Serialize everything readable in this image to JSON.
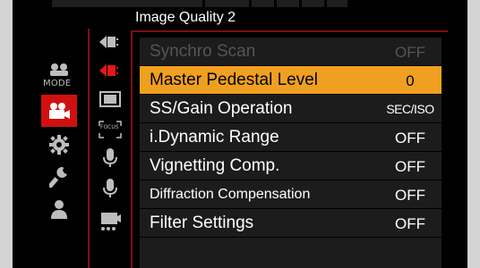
{
  "header": {
    "title": "Image Quality 2"
  },
  "categories": [
    {
      "name": "mode",
      "label": "MODE",
      "active": false
    },
    {
      "name": "motion-picture",
      "active": true
    },
    {
      "name": "custom-gear",
      "active": false
    },
    {
      "name": "setup-wrench",
      "active": false
    },
    {
      "name": "my-menu-person",
      "active": false
    }
  ],
  "tabs": [
    {
      "name": "image-quality-1"
    },
    {
      "name": "image-quality-2",
      "active": true
    },
    {
      "name": "image-format"
    },
    {
      "name": "focus",
      "label": "FOCUS"
    },
    {
      "name": "audio-1"
    },
    {
      "name": "audio-2"
    },
    {
      "name": "other-functions"
    }
  ],
  "menu": {
    "items": [
      {
        "label": "Synchro Scan",
        "value": "OFF",
        "state": "disabled"
      },
      {
        "label": "Master Pedestal Level",
        "value": "0",
        "state": "selected"
      },
      {
        "label": "SS/Gain Operation",
        "value": "SEC/ISO",
        "state": "normal"
      },
      {
        "label": "i.Dynamic Range",
        "value": "OFF",
        "state": "normal"
      },
      {
        "label": "Vignetting Comp.",
        "value": "OFF",
        "state": "normal"
      },
      {
        "label": "Diffraction Compensation",
        "value": "OFF",
        "state": "normal"
      },
      {
        "label": "Filter Settings",
        "value": "OFF",
        "state": "normal"
      }
    ]
  },
  "colors": {
    "accent_red": "#d01010",
    "selected_bg": "#f0a020",
    "row_bg": "#1c1c1c"
  }
}
